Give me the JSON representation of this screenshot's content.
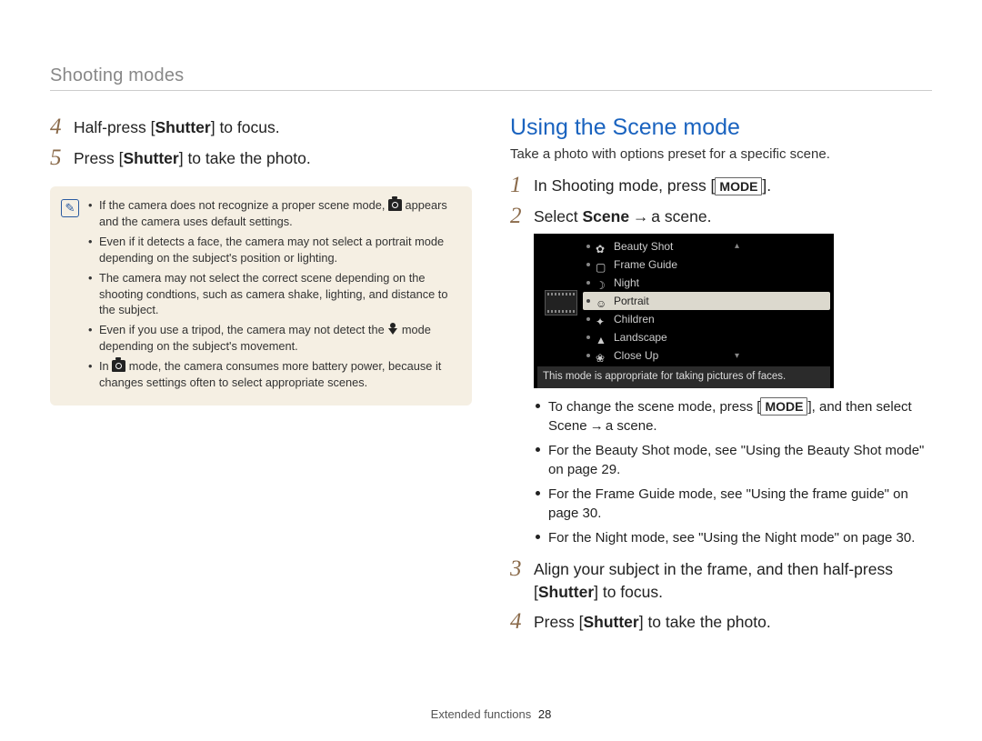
{
  "header": {
    "title": "Shooting modes"
  },
  "left": {
    "steps": [
      {
        "num": "4",
        "pre": "Half-press [",
        "strong": "Shutter",
        "post": "] to focus."
      },
      {
        "num": "5",
        "pre": "Press [",
        "strong": "Shutter",
        "post": "] to take the photo."
      }
    ],
    "notes": [
      {
        "pre": "If the camera does not recognize a proper scene mode, ",
        "icon": "smart-scene-icon",
        "mid": " appears and the camera uses default settings.",
        "post": ""
      },
      {
        "pre": "Even if it detects a face, the camera may not select a portrait mode depending on the subject's position or lighting.",
        "icon": "",
        "mid": "",
        "post": ""
      },
      {
        "pre": "The camera may not select the correct scene depending on the shooting condtions, such as camera shake, lighting, and distance to the subject.",
        "icon": "",
        "mid": "",
        "post": ""
      },
      {
        "pre": "Even if you use a tripod, the camera may not detect the ",
        "icon": "tripod-icon",
        "mid": " mode depending on the subject's movement.",
        "post": ""
      },
      {
        "pre": "In ",
        "icon": "smart-scene-icon",
        "mid": " mode, the camera consumes more battery power, because it changes settings often to select appropriate scenes.",
        "post": ""
      }
    ]
  },
  "right": {
    "heading": "Using the Scene mode",
    "intro": "Take a photo with options preset for a specific scene.",
    "step1": {
      "num": "1",
      "pre": "In Shooting mode, press [",
      "key": "MODE",
      "post": "]."
    },
    "step2": {
      "num": "2",
      "pre": "Select ",
      "strong": "Scene",
      "arrow": " → ",
      "post": "a scene."
    },
    "menu": {
      "items": [
        {
          "label": "Beauty Shot",
          "selected": false
        },
        {
          "label": "Frame Guide",
          "selected": false
        },
        {
          "label": "Night",
          "selected": false
        },
        {
          "label": "Portrait",
          "selected": true
        },
        {
          "label": "Children",
          "selected": false
        },
        {
          "label": "Landscape",
          "selected": false
        },
        {
          "label": "Close Up",
          "selected": false
        }
      ],
      "caption": "This mode is appropriate for taking pictures of faces."
    },
    "bullets": [
      {
        "pre": "To change the scene mode, press [",
        "key": "MODE",
        "mid": "], and then select ",
        "strong": "Scene",
        "arrow": " → ",
        "post": "a scene."
      },
      {
        "pre": "For the Beauty Shot mode, see \"Using the Beauty Shot mode\" on page 29.",
        "key": "",
        "mid": "",
        "strong": "",
        "arrow": "",
        "post": ""
      },
      {
        "pre": "For the Frame Guide mode, see \"Using the frame guide\" on page 30.",
        "key": "",
        "mid": "",
        "strong": "",
        "arrow": "",
        "post": ""
      },
      {
        "pre": "For the Night mode, see \"Using the Night mode\" on page 30.",
        "key": "",
        "mid": "",
        "strong": "",
        "arrow": "",
        "post": ""
      }
    ],
    "step3": {
      "num": "3",
      "pre": "Align your subject in the frame, and then half-press [",
      "strong": "Shutter",
      "post": "] to focus."
    },
    "step4": {
      "num": "4",
      "pre": "Press [",
      "strong": "Shutter",
      "post": "] to take the photo."
    }
  },
  "footer": {
    "section": "Extended functions",
    "page": "28"
  }
}
